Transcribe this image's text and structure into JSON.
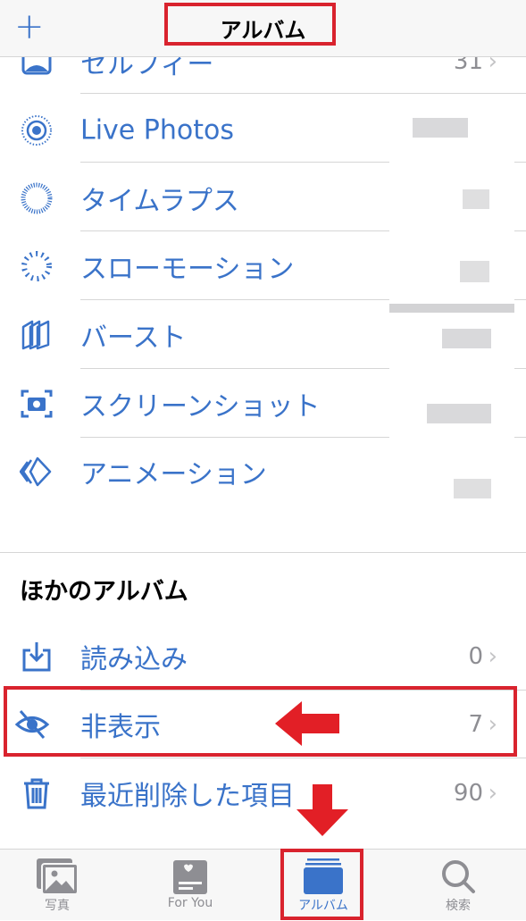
{
  "nav": {
    "title": "アルバム",
    "add_icon": "plus-icon"
  },
  "media_types": [
    {
      "label": "セルフィー",
      "count": "31",
      "icon": "selfie-icon"
    },
    {
      "label": "Live Photos",
      "count": "",
      "icon": "live-photos-icon"
    },
    {
      "label": "タイムラプス",
      "count": "",
      "icon": "timelapse-icon"
    },
    {
      "label": "スローモーション",
      "count": "",
      "icon": "slow-motion-icon"
    },
    {
      "label": "バースト",
      "count": "",
      "icon": "burst-icon"
    },
    {
      "label": "スクリーンショット",
      "count": "",
      "icon": "screenshot-icon"
    },
    {
      "label": "アニメーション",
      "count": "",
      "icon": "animation-icon"
    }
  ],
  "other_section": {
    "title": "ほかのアルバム",
    "items": [
      {
        "label": "読み込み",
        "count": "0",
        "icon": "import-icon"
      },
      {
        "label": "非表示",
        "count": "7",
        "icon": "hidden-eye-icon"
      },
      {
        "label": "最近削除した項目",
        "count": "90",
        "icon": "trash-icon"
      }
    ]
  },
  "tabs": [
    {
      "label": "写真"
    },
    {
      "label": "For You"
    },
    {
      "label": "アルバム",
      "active": true
    },
    {
      "label": "検索"
    }
  ],
  "colors": {
    "accent": "#3a73c9",
    "highlight": "#d9232e"
  }
}
